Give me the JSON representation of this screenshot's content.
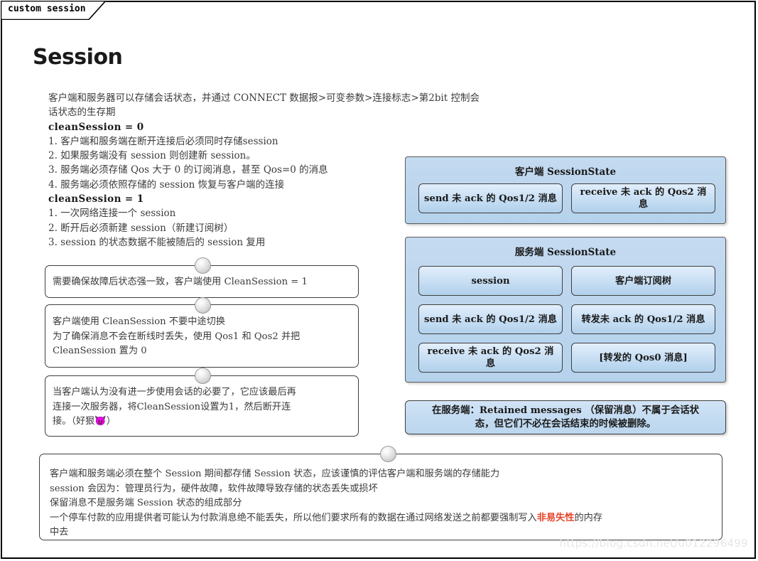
{
  "frame": {
    "tab_label": "custom session"
  },
  "page_title": "Session",
  "body_text": {
    "line1": "客户端和服务器可以存储会话状态，并通过 CONNECT 数据报>可变参数>连接标志>第2bit 控制会",
    "line2": "话状态的生存期",
    "heading_clean0": "cleanSession = 0",
    "item0_1": "1. 客户端和服务端在断开连接后必须同时存储session",
    "item0_2": "2. 如果服务端没有 session 则创建新 session。",
    "item0_3": "3. 服务端必须存储 Qos 大于 0 的订阅消息，甚至 Qos=0 的消息",
    "item0_4": "4. 服务端必须依照存储的 session 恢复与客户端的连接",
    "heading_clean1": "cleanSession = 1",
    "item1_1": "1. 一次网络连接一个 session",
    "item1_2": "2. 断开后必须新建 session（新建订阅树）",
    "item1_3": "3. session 的状态数据不能被随后的 session 复用"
  },
  "notes": [
    {
      "name": "note-strong-consistency",
      "lines": [
        "需要确保故障后状态强一致，客户端使用 CleanSession = 1"
      ]
    },
    {
      "name": "note-no-midway-switch",
      "lines": [
        "客户端使用 CleanSession 不要中途切换",
        "为了确保消息不会在断线时丢失，使用 Qos1 和 Qos2 并把",
        "CleanSession 置为 0"
      ]
    },
    {
      "name": "note-final-disconnect",
      "lines": [
        "当客户端认为没有进一步使用会话的必要了，它应该最后再",
        "连接一次服务器，将CleanSession设置为1，然后断开连",
        "接。（好狠😈）"
      ]
    }
  ],
  "bottom_note": {
    "line1": "客户端和服务端必须在整个 Session 期间都存储 Session 状态，应该谨慎的评估客户端和服务端的存储能力",
    "line2": "session 会因为：管理员行为，硬件故障，软件故障导致存储的状态丢失或损坏",
    "line3": "保留消息不是服务端 Session 状态的组成部分",
    "line4_pre": "一个停车付款的应用提供者可能认为付款消息绝不能丢失，所以他们要求所有的数据在通过网络发送之前都要强制写入",
    "line4_highlight": "非易失性",
    "line4_post": "的内存",
    "line5": "中去",
    "highlight_color": "#e8452c"
  },
  "client_session_state": {
    "title": "客户端 SessionState",
    "cells": [
      "send 未 ack 的 Qos1/2 消息",
      "receive 未 ack 的 Qos2 消息"
    ]
  },
  "server_session_state": {
    "title": "服务端 SessionState",
    "cells": [
      "session",
      "客户端订阅树",
      "send 未 ack 的 Qos1/2 消息",
      "转发未 ack 的 Qos1/2 消息",
      "receive 未 ack 的 Qos2 消息",
      "[转发的 Qos0 消息]"
    ]
  },
  "retained_note": {
    "line1": "在服务端：Retained messages （保留消息）不属于会话状",
    "line2": "态，但它们不必在会话结束的时候被删除。"
  },
  "watermark": "https://blog.csdn.net/u012296499",
  "colors": {
    "panel_blue": "#bcd6ee",
    "cell_blue": "#cfe3f6",
    "border": "#3f3f3f",
    "text": "#3b3b3b"
  }
}
